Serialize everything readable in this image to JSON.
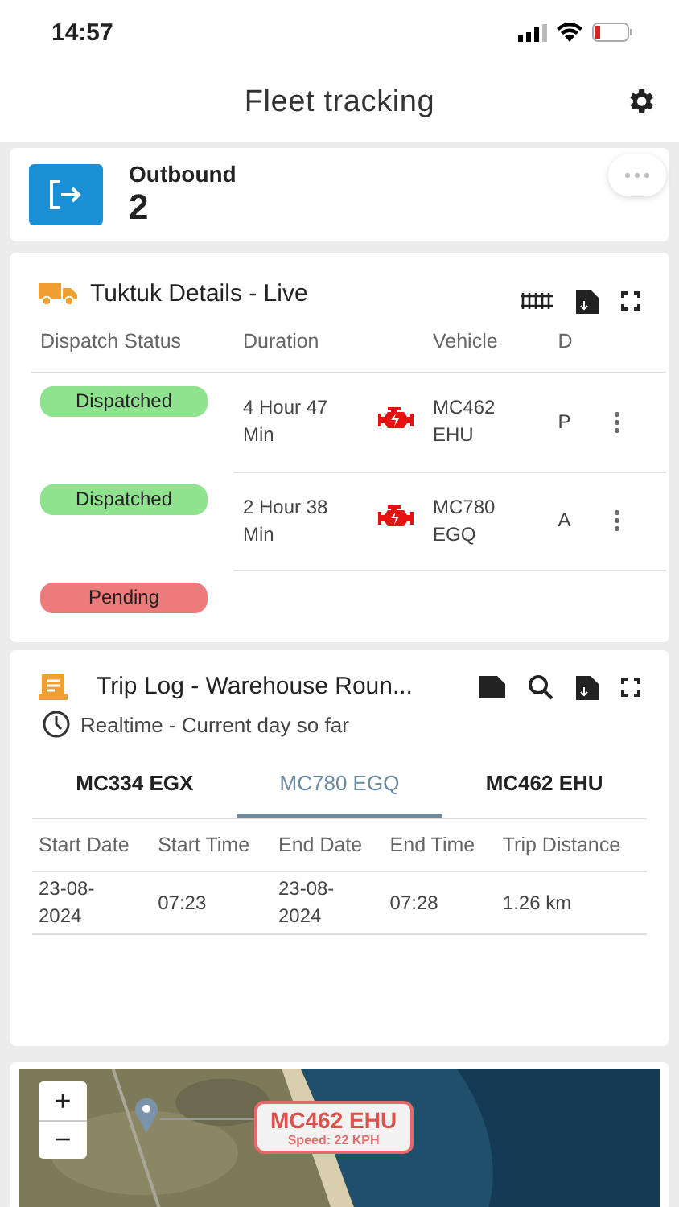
{
  "status_bar": {
    "time": "14:57"
  },
  "header": {
    "title": "Fleet tracking"
  },
  "outbound": {
    "label": "Outbound",
    "count": "2"
  },
  "tuktuk": {
    "title": "Tuktuk Details - Live",
    "columns": [
      "Dispatch Status",
      "Duration",
      "",
      "Vehicle",
      "D"
    ],
    "rows": [
      {
        "status": "Dispatched",
        "kind": "dispatched",
        "duration": "4 Hour 47 Min",
        "engine_alert": true,
        "vehicle": "MC462 EHU",
        "column_5": "P"
      },
      {
        "status": "Dispatched",
        "kind": "dispatched",
        "duration": "2 Hour 38 Min",
        "engine_alert": true,
        "vehicle": "MC780 EGQ",
        "column_5": "A"
      },
      {
        "status": "Pending",
        "kind": "pending"
      }
    ]
  },
  "trip_log": {
    "title": "Trip Log - Warehouse Roun...",
    "subtitle": "Realtime - Current day so far",
    "tabs": [
      {
        "label": "MC334 EGX",
        "selected": false
      },
      {
        "label": "MC780 EGQ",
        "selected": true
      },
      {
        "label": "MC462 EHU",
        "selected": false
      }
    ],
    "columns": [
      "Start Date",
      "Start Time",
      "End Date",
      "End Time",
      "Trip Distance"
    ],
    "rows": [
      [
        "23-08-2024",
        "07:23",
        "23-08-2024",
        "07:28",
        "1.26 km"
      ]
    ]
  },
  "map": {
    "zoom_in": "+",
    "zoom_out": "−",
    "marker": {
      "vehicle": "MC462 EHU",
      "speed": "Speed: 22 KPH"
    }
  }
}
